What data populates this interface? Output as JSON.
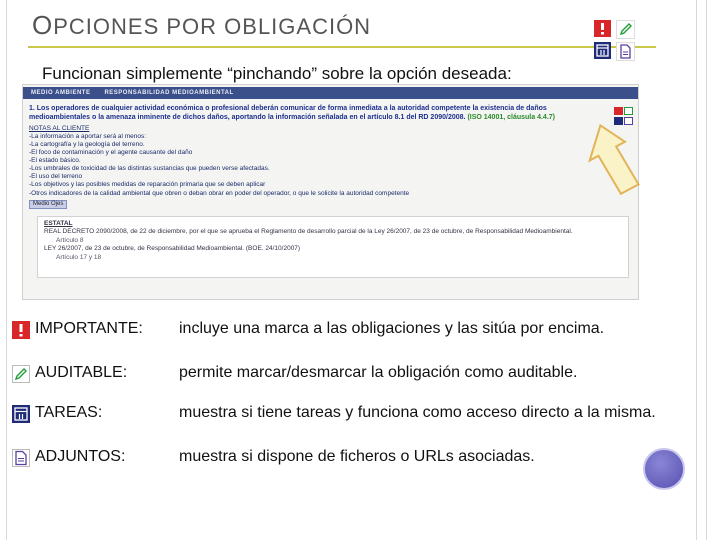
{
  "slide": {
    "title_first_letter": "O",
    "title_rest": "PCIONES POR OBLIGACIÓN",
    "subtitle": "Funcionan simplemente “pinchando” sobre la opción deseada:"
  },
  "colors": {
    "important_red": "#d8262b",
    "auditable_green": "#1f9e3a",
    "tasks_navy": "#1e2b78",
    "attach_purple": "#5a3fa0",
    "title_rule": "#c8c84a",
    "orb": "#6660c0"
  },
  "icons": {
    "important": "exclamation-icon",
    "auditable": "pencil-icon",
    "tasks": "calendar-icon",
    "attachments": "document-icon"
  },
  "screenshot": {
    "tabs": [
      "MEDIO AMBIENTE",
      "RESPONSABILIDAD MEDIOAMBIENTAL"
    ],
    "obligation_prefix": "1. Los operadores de cualquier actividad económica o profesional deberán comunicar de forma inmediata a la autoridad competente la existencia de daños medioambientales o la amenaza inminente de dichos daños, aportando la información señalada en el artículo 8.1 del RD 2090/2008.",
    "obligation_refs": "(ISO 14001, cláusula 4.4.7)",
    "section_label": "NOTAS AL CLIENTE",
    "notes": [
      "-La información a aportar será al menos:",
      "-La cartografía y la geología del terreno.",
      "-El foco de contaminación y el agente causante del daño",
      "-El estado básico.",
      "-Los umbrales de toxicidad de las distintas sustancias que pueden verse afectadas.",
      "-El uso del terreno",
      "-Los objetivos y las posibles medidas de reparación primaria que se deben aplicar",
      "-Otros indicadores de la calidad ambiental que obren o deban obrar en poder del operador, o que le solicite la autoridad competente"
    ],
    "more_button": "Medio Ojes",
    "panel_title": "ESTATAL",
    "panel_lines": [
      "REAL DECRETO 2090/2008, de 22 de diciembre, por el que se aprueba el Reglamento de desarrollo parcial de la Ley 26/2007, de 23 de octubre, de Responsabilidad Medioambiental.",
      "Artículo 8",
      "LEY 26/2007, de 23 de octubre, de Responsabilidad Medioambiental. (BOE. 24/10/2007)",
      "Artículo 17 y 18"
    ]
  },
  "legend": [
    {
      "name": "IMPORTANTE:",
      "description": "incluye una marca a las obligaciones y las sitúa por encima."
    },
    {
      "name": "AUDITABLE:",
      "description": "permite marcar/desmarcar la obligación como auditable."
    },
    {
      "name": "TAREAS:",
      "description": "muestra si tiene tareas y funciona como acceso directo a la misma."
    },
    {
      "name": "ADJUNTOS:",
      "description": "muestra si dispone de ficheros o URLs asociadas."
    }
  ]
}
